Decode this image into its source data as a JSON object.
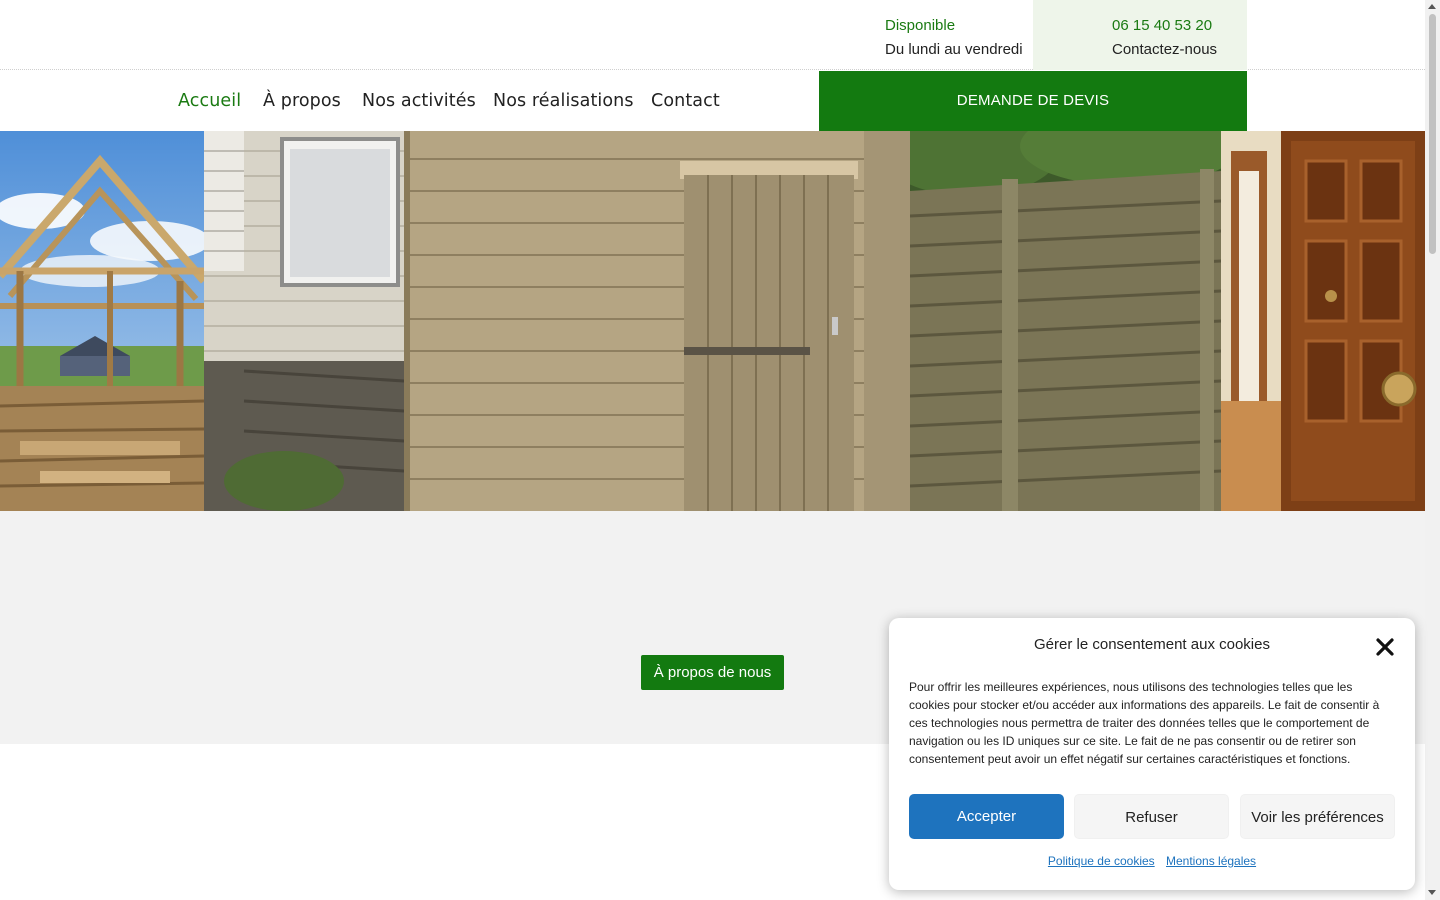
{
  "topbar": {
    "availability_title": "Disponible",
    "availability_sub": "Du lundi au vendredi",
    "phone": "06 15 40 53 20",
    "contact_label": "Contactez-nous"
  },
  "nav": {
    "items": [
      {
        "label": "Accueil",
        "active": true
      },
      {
        "label": "À propos",
        "active": false
      },
      {
        "label": "Nos activités",
        "active": false
      },
      {
        "label": "Nos réalisations",
        "active": false
      },
      {
        "label": "Contact",
        "active": false
      }
    ],
    "cta": "DEMANDE DE DEVIS"
  },
  "hero": {
    "panels": [
      "roof-frame-image",
      "mobile-home-wall-image",
      "wooden-shed-image",
      "wooden-fence-image",
      "wooden-door-image"
    ]
  },
  "section": {
    "button": "À propos de nous"
  },
  "cookie": {
    "title": "Gérer le consentement aux cookies",
    "text": "Pour offrir les meilleures expériences, nous utilisons des technologies telles que les cookies pour stocker et/ou accéder aux informations des appareils. Le fait de consentir à ces technologies nous permettra de traiter des données telles que le comportement de navigation ou les ID uniques sur ce site. Le fait de ne pas consentir ou de retirer son consentement peut avoir un effet négatif sur certaines caractéristiques et fonctions.",
    "accept": "Accepter",
    "refuse": "Refuser",
    "preferences": "Voir les préférences",
    "link_policy": "Politique de cookies",
    "link_legal": "Mentions légales"
  },
  "colors": {
    "brand_green": "#137a10",
    "accent_blue": "#1e73be",
    "grey_bg": "#f2f2f2"
  }
}
